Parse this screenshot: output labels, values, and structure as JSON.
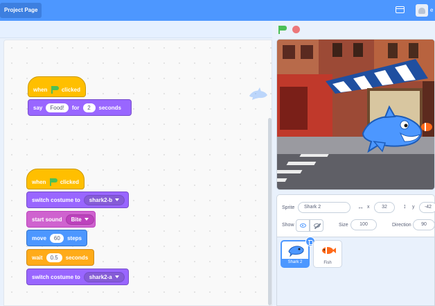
{
  "menubar": {
    "project_page_label": "Project Page",
    "user_name_fragment": "e"
  },
  "scripts": [
    {
      "hat": {
        "label": "when",
        "suffix": "clicked",
        "icon": "green-flag-icon"
      },
      "blocks": [
        {
          "category": "looks",
          "text1": "say",
          "value1": "Food!",
          "text2": "for",
          "value2": "2",
          "text3": "seconds"
        }
      ]
    },
    {
      "hat": {
        "label": "when",
        "suffix": "clicked",
        "icon": "green-flag-icon"
      },
      "blocks": [
        {
          "category": "looks",
          "text1": "switch costume to",
          "dropdown": "shark2-b"
        },
        {
          "category": "sound",
          "text1": "start sound",
          "dropdown": "Bite"
        },
        {
          "category": "motion",
          "text1": "move",
          "value1": "60",
          "text2": "steps"
        },
        {
          "category": "control",
          "text1": "wait",
          "value1": "0.5",
          "text2": "seconds"
        },
        {
          "category": "looks",
          "text1": "switch costume to",
          "dropdown": "shark2-a"
        }
      ]
    }
  ],
  "sprite_info": {
    "sprite_label": "Sprite",
    "sprite_name": "Shark 2",
    "x_label": "x",
    "x_value": "32",
    "y_label": "y",
    "y_value": "-42",
    "show_label": "Show",
    "size_label": "Size",
    "size_value": "100",
    "direction_label": "Direction",
    "direction_value": "90"
  },
  "sprites": [
    {
      "name": "Shark 2",
      "selected": true
    },
    {
      "name": "Fish",
      "selected": false
    }
  ],
  "colors": {
    "menubar": "#4d97ff",
    "events": "#ffbf00",
    "looks": "#9966ff",
    "sound": "#cf63cf",
    "motion": "#4c97ff",
    "control": "#ffab19"
  }
}
